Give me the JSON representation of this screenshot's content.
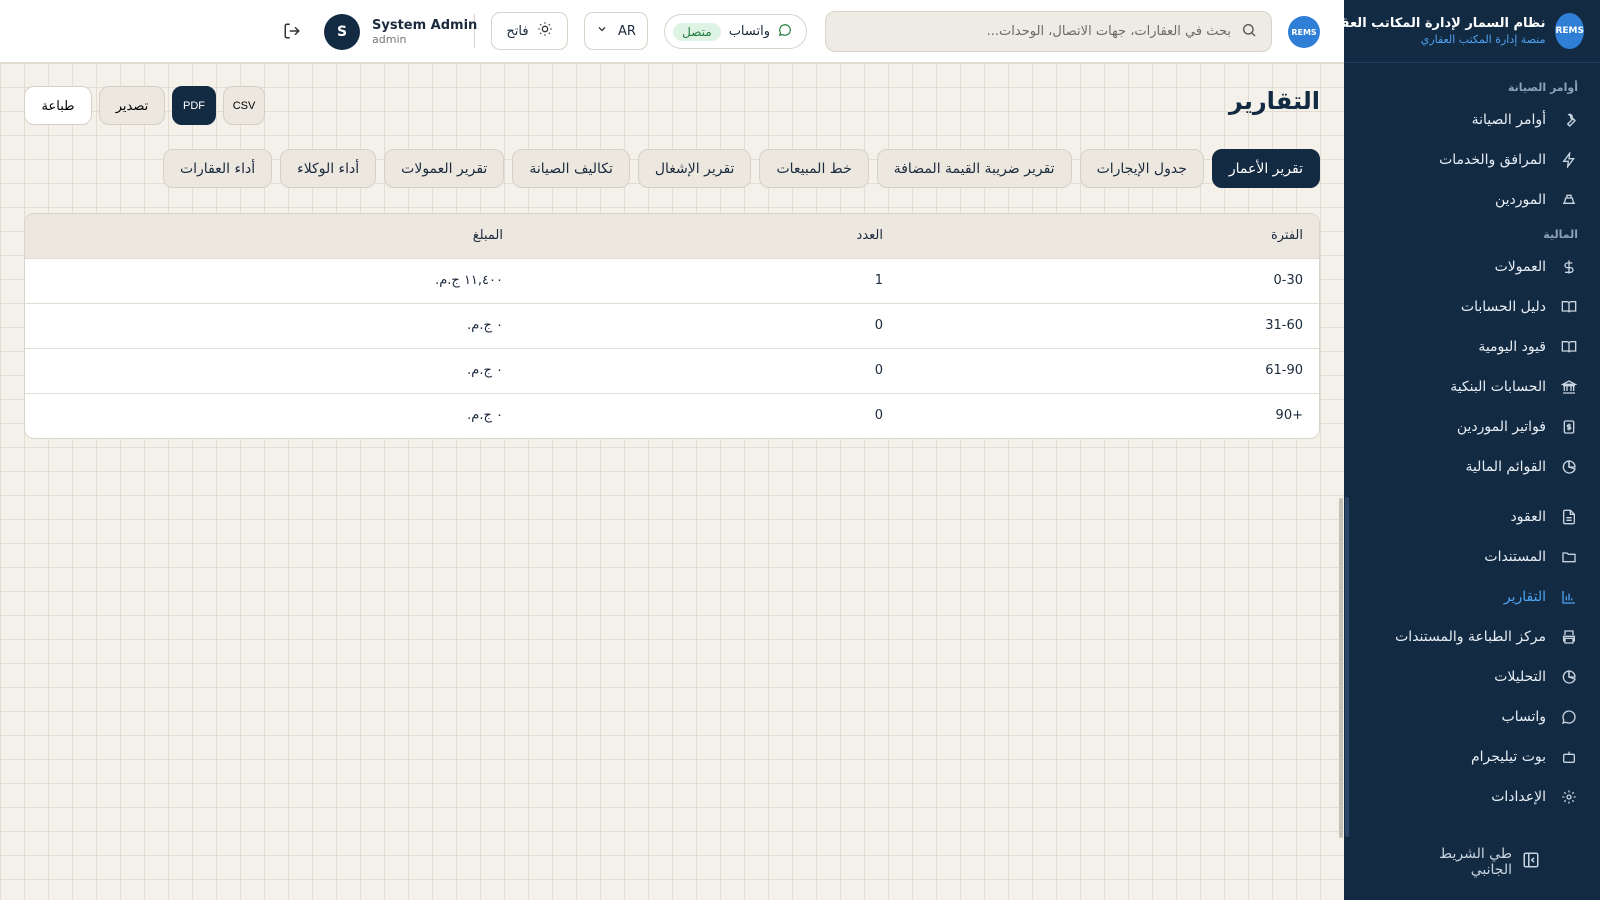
{
  "brand": {
    "logo_text": "REMS",
    "title": "نظام السمار لإدارة المكاتب العقارية",
    "subtitle": "منصة إدارة المكتب العقاري"
  },
  "sidebar": {
    "sections": [
      {
        "title": "أوامر الصيانة",
        "items": [
          {
            "label": "أوامر الصيانة",
            "icon": "wrench-icon"
          },
          {
            "label": "المرافق والخدمات",
            "icon": "lightning-icon"
          },
          {
            "label": "الموردين",
            "icon": "truck-icon"
          }
        ]
      },
      {
        "title": "المالية",
        "items": [
          {
            "label": "العمولات",
            "icon": "dollar-icon"
          },
          {
            "label": "دليل الحسابات",
            "icon": "book-icon"
          },
          {
            "label": "قيود اليومية",
            "icon": "book-icon"
          },
          {
            "label": "الحسابات البنكية",
            "icon": "bank-icon"
          },
          {
            "label": "فواتير الموردين",
            "icon": "invoice-icon"
          },
          {
            "label": "القوائم المالية",
            "icon": "pie-chart-icon"
          }
        ]
      },
      {
        "title": "",
        "items": [
          {
            "label": "العقود",
            "icon": "file-icon"
          },
          {
            "label": "المستندات",
            "icon": "folder-icon"
          },
          {
            "label": "التقارير",
            "icon": "bar-chart-icon",
            "active": true
          },
          {
            "label": "مركز الطباعة والمستندات",
            "icon": "printer-icon"
          },
          {
            "label": "التحليلات",
            "icon": "pie-chart-icon"
          },
          {
            "label": "واتساب",
            "icon": "chat-icon"
          },
          {
            "label": "بوت تيليجرام",
            "icon": "bot-icon"
          },
          {
            "label": "الإعدادات",
            "icon": "gear-icon"
          }
        ]
      }
    ],
    "collapse_label": "طي الشريط الجانبي"
  },
  "header": {
    "search_placeholder": "بحث في العقارات، جهات الاتصال، الوحدات...",
    "whatsapp_label": "واتساب",
    "whatsapp_status": "متصل",
    "language": "AR",
    "theme_label": "فاتح",
    "user_name": "System Admin",
    "user_role": "admin",
    "user_initial": "S"
  },
  "page": {
    "title": "التقارير",
    "actions": {
      "print": "طباعة",
      "export": "تصدير",
      "pdf": "PDF",
      "csv": "CSV"
    },
    "tabs": [
      {
        "label": "تقرير الأعمار",
        "active": true
      },
      {
        "label": "جدول الإيجارات"
      },
      {
        "label": "تقرير ضريبة القيمة المضافة"
      },
      {
        "label": "خط المبيعات"
      },
      {
        "label": "تقرير الإشغال"
      },
      {
        "label": "تكاليف الصيانة"
      },
      {
        "label": "تقرير العمولات"
      },
      {
        "label": "أداء الوكلاء"
      },
      {
        "label": "أداء العقارات"
      }
    ],
    "table": {
      "headers": {
        "period": "الفترة",
        "count": "العدد",
        "amount": "المبلغ"
      },
      "rows": [
        {
          "period": "0-30",
          "count": "1",
          "amount": "١١,٤٠٠ ج.م."
        },
        {
          "period": "31-60",
          "count": "0",
          "amount": "٠ ج.م."
        },
        {
          "period": "61-90",
          "count": "0",
          "amount": "٠ ج.م."
        },
        {
          "period": "+90",
          "count": "0",
          "amount": "٠ ج.م."
        }
      ]
    }
  }
}
